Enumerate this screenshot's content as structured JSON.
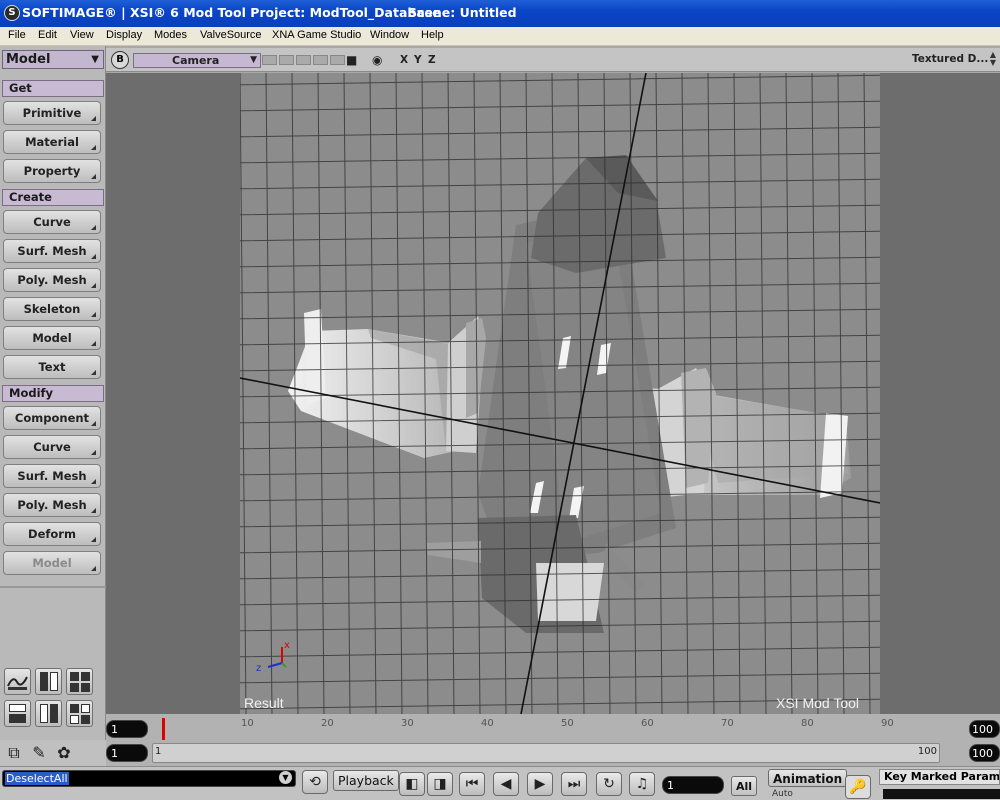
{
  "window": {
    "title": "SOFTIMAGE® | XSI® 6 Mod Tool Project: ModTool_Database",
    "scene": "Scene: Untitled",
    "icon": "softimage-logo-icon"
  },
  "menu": [
    "File",
    "Edit",
    "View",
    "Display",
    "Modes",
    "ValveSource",
    "XNA Game Studio",
    "Window",
    "Help"
  ],
  "toolbar": {
    "mode": "Model",
    "sections": {
      "get": {
        "label": "Get",
        "buttons": [
          "Primitive",
          "Material",
          "Property"
        ]
      },
      "create": {
        "label": "Create",
        "buttons": [
          "Curve",
          "Surf. Mesh",
          "Poly. Mesh",
          "Skeleton",
          "Model",
          "Text"
        ]
      },
      "modify": {
        "label": "Modify",
        "buttons": [
          "Component",
          "Curve",
          "Surf. Mesh",
          "Poly. Mesh",
          "Deform",
          "Model"
        ]
      }
    }
  },
  "viewport": {
    "badge": "B",
    "camera": "Camera",
    "axes": [
      "X",
      "Y",
      "Z"
    ],
    "display_mode": "Textured D...",
    "label_left": "Result",
    "label_right": "XSI Mod Tool",
    "grid_color": "#2b2b2b",
    "background": "#8c8c8c"
  },
  "timeline": {
    "start_frame": "1",
    "end_frame": "100",
    "current_frame": 1,
    "ticks": [
      "10",
      "20",
      "30",
      "40",
      "50",
      "60",
      "70",
      "80",
      "90"
    ],
    "range_start": "1",
    "range_start_label": "1",
    "range_end_label": "100",
    "range_end": "100"
  },
  "command": {
    "value": "DeselectAll"
  },
  "playback": {
    "label": "Playback",
    "frame": "1",
    "all_label": "All",
    "animation_label": "Animation",
    "animation_sub": "Auto",
    "key_label": "Key Marked Parame"
  }
}
